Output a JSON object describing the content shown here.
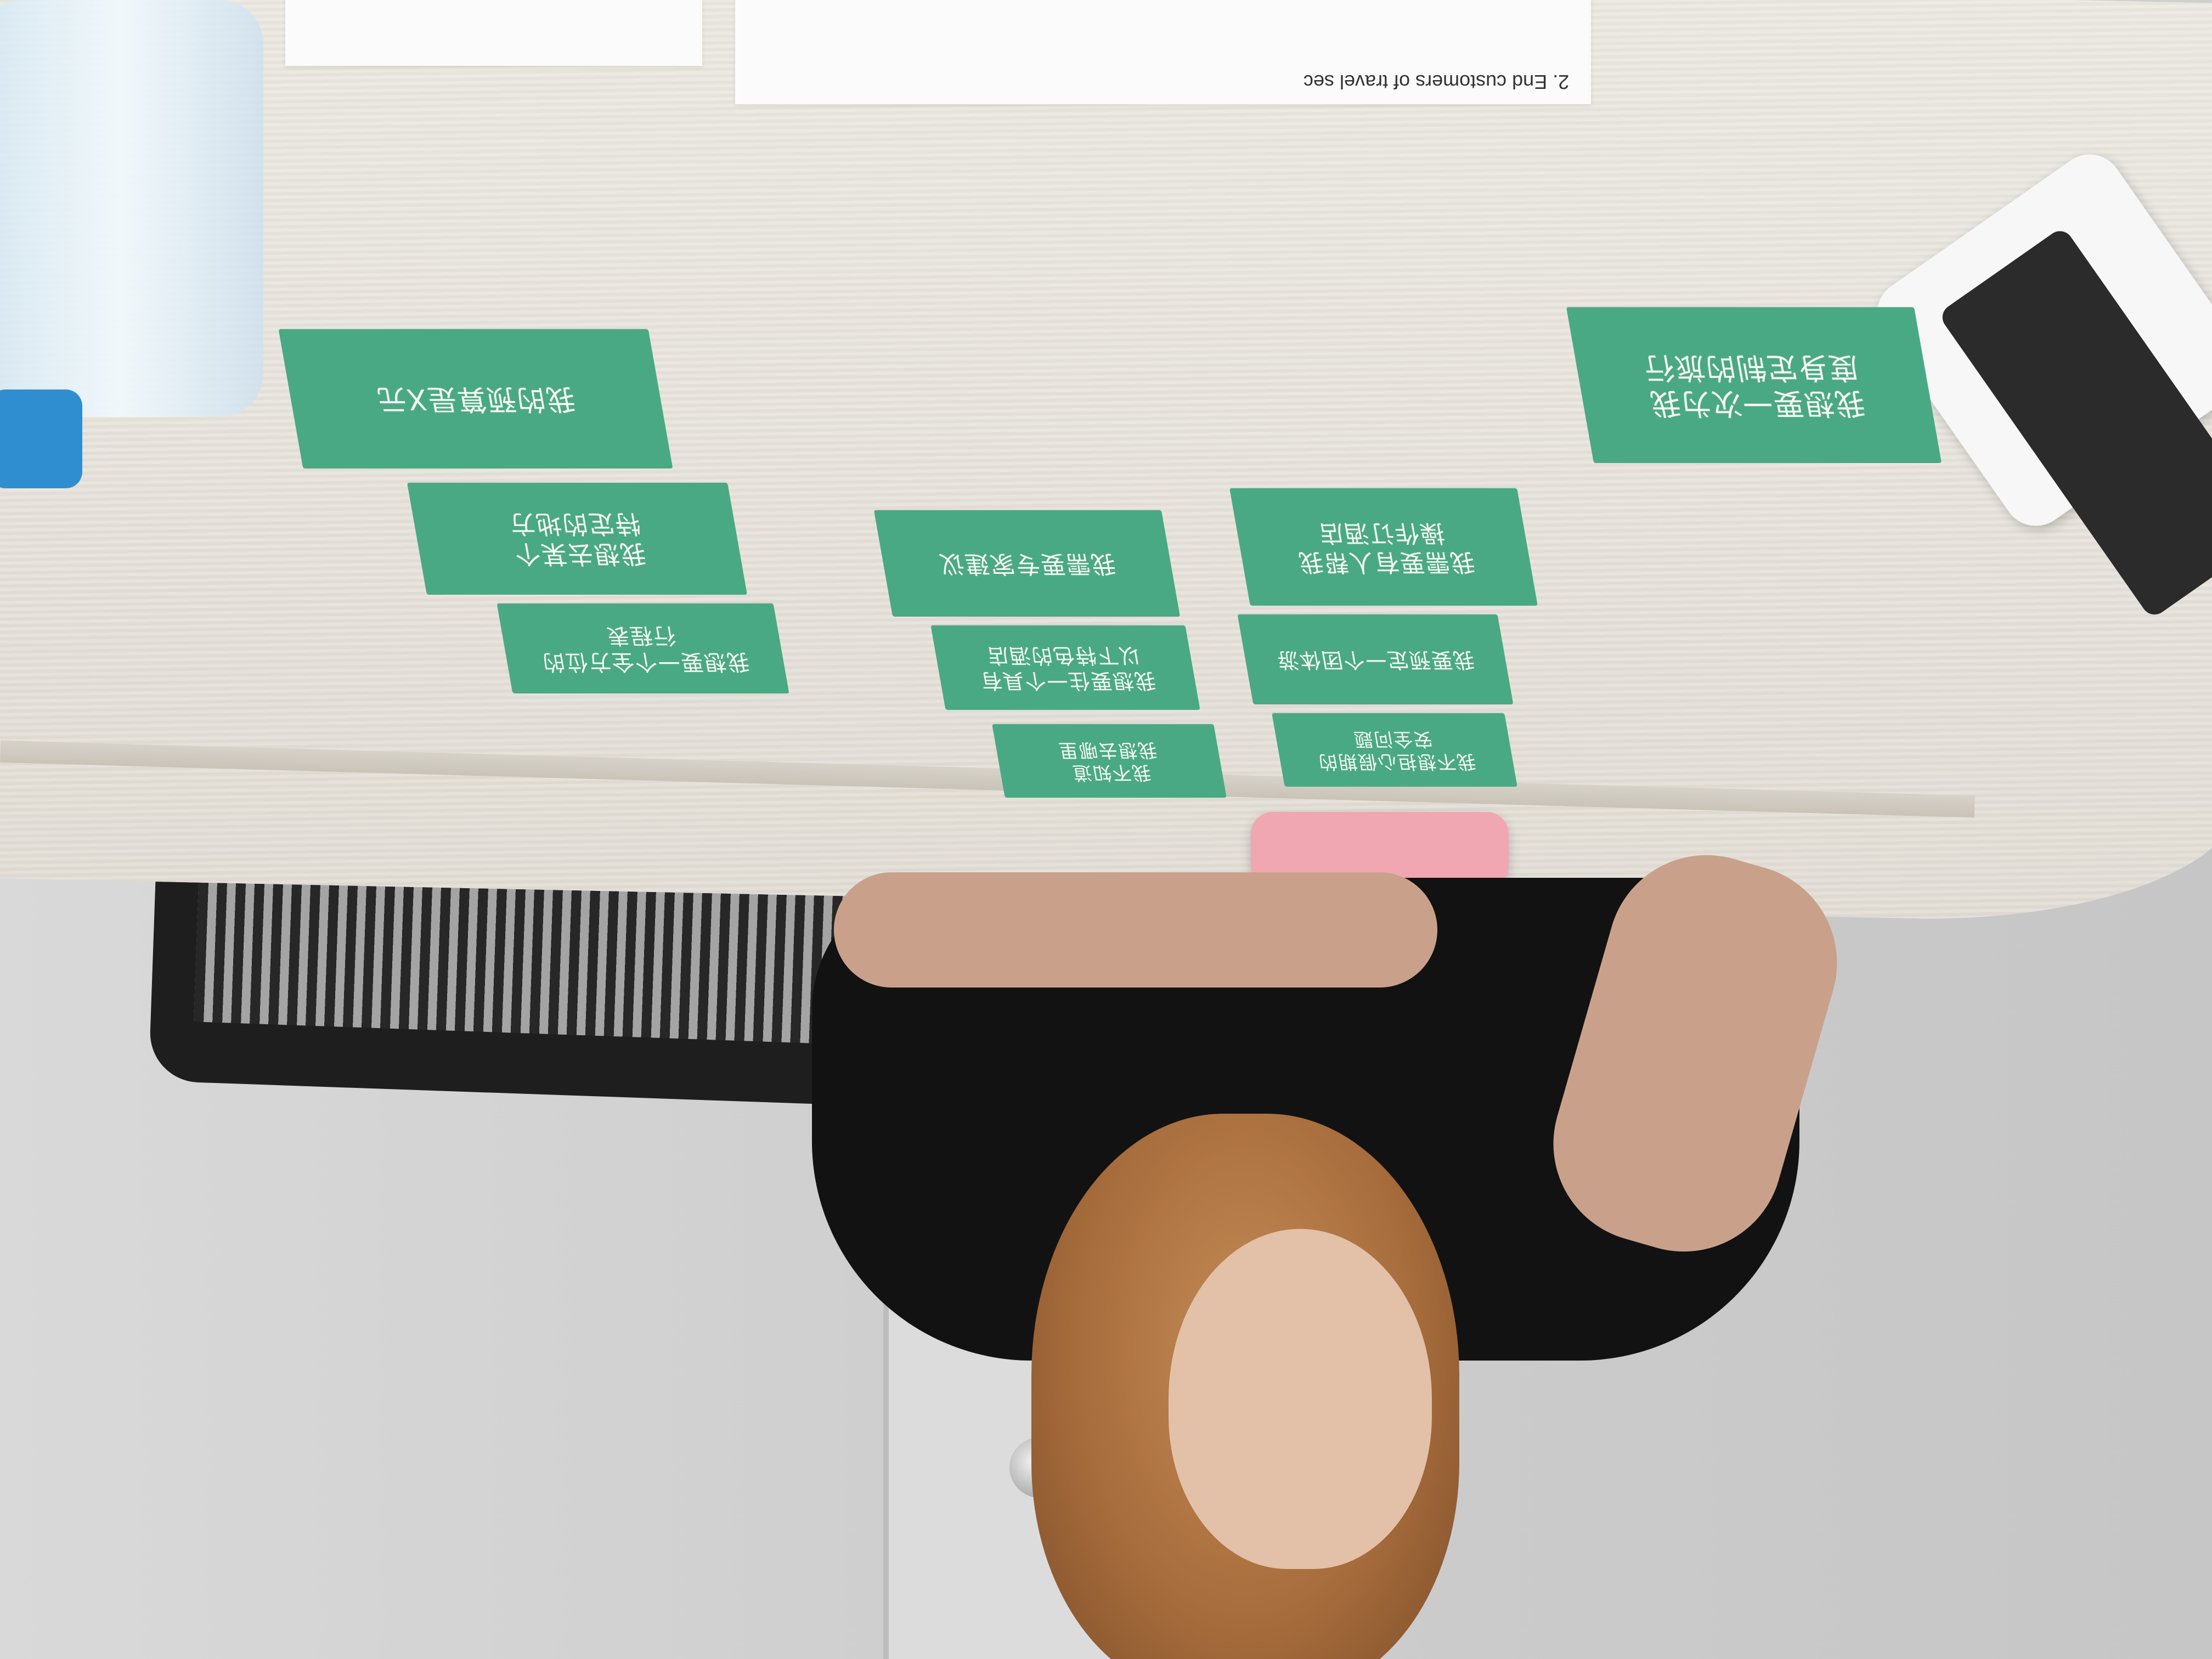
{
  "cards": [
    {
      "text": "我想要一次为我\n度身定制的旅行"
    },
    {
      "text": "我的预算是X元"
    },
    {
      "text": "我想去某个\n特定的地方"
    },
    {
      "text": "我想要一个全方位的\n行程表"
    },
    {
      "text": "我需要专家建议"
    },
    {
      "text": "我想要住一个具有\n以下特色的酒店"
    },
    {
      "text": "我不知道\n我想去哪里"
    },
    {
      "text": "我需要有人帮我\n操作订酒店"
    },
    {
      "text": "我要预定一个团体游"
    },
    {
      "text": "我不想担心假期的\n安全问题"
    }
  ],
  "paper_text": "2. End customers of travel sec",
  "colors": {
    "card_green": "#4aa985",
    "table": "#e7e3dc",
    "wall": "#cfcfcf"
  }
}
